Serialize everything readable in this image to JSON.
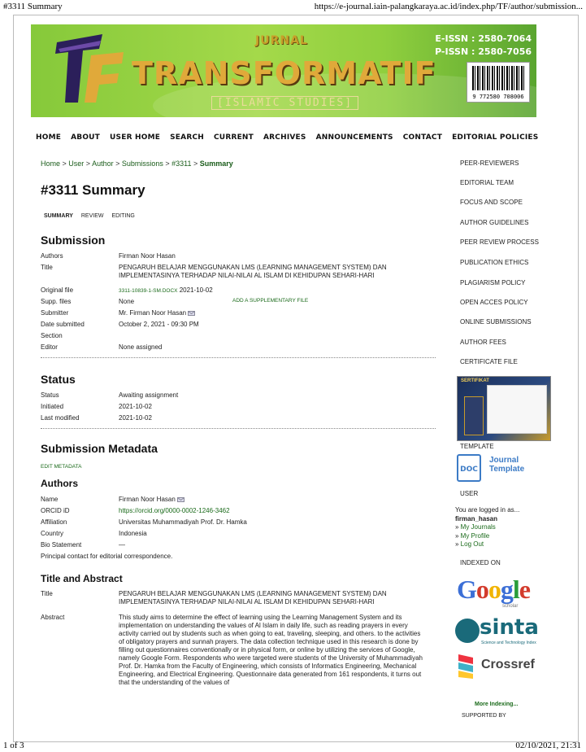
{
  "print_header": {
    "title": "#3311 Summary",
    "url": "https://e-journal.iain-palangkaraya.ac.id/index.php/TF/author/submission..."
  },
  "print_footer": {
    "page": "1 of 3",
    "datetime": "02/10/2021, 21:31"
  },
  "banner": {
    "jurnal": "JURNAL",
    "name": "TRANSFORMATIF",
    "subtitle": "[ISLAMIC STUDIES]",
    "eissn": "E-ISSN : 2580-7064",
    "pissn": "P-ISSN : 2580-7056",
    "barcode_number": "9 772580 708006"
  },
  "nav": [
    "HOME",
    "ABOUT",
    "USER HOME",
    "SEARCH",
    "CURRENT",
    "ARCHIVES",
    "ANNOUNCEMENTS",
    "CONTACT",
    "EDITORIAL POLICIES"
  ],
  "breadcrumb": {
    "items": [
      "Home",
      "User",
      "Author",
      "Submissions",
      "#3311"
    ],
    "sep": " > ",
    "current": "Summary"
  },
  "page_title": "#3311 Summary",
  "tabs": {
    "summary": "SUMMARY",
    "review": "REVIEW",
    "editing": "EDITING"
  },
  "submission": {
    "heading": "Submission",
    "authors_label": "Authors",
    "authors": "Firman Noor Hasan",
    "title_label": "Title",
    "title": "PENGARUH BELAJAR MENGGUNAKAN LMS (LEARNING MANAGEMENT SYSTEM) DAN IMPLEMENTASINYA TERHADAP NILAI-NILAI AL ISLAM DI KEHIDUPAN SEHARI-HARI",
    "file_label": "Original file",
    "file_name": "3311-10839-1-SM.DOCX",
    "file_date": "2021-10-02",
    "supp_label": "Supp. files",
    "supp": "None",
    "add_supp": "ADD A SUPPLEMENTARY FILE",
    "submitter_label": "Submitter",
    "submitter": "Mr. Firman Noor Hasan",
    "date_label": "Date submitted",
    "date": "October 2, 2021 - 09:30 PM",
    "section_label": "Section",
    "editor_label": "Editor",
    "editor": "None assigned"
  },
  "status": {
    "heading": "Status",
    "status_label": "Status",
    "status": "Awaiting assignment",
    "initiated_label": "Initiated",
    "initiated": "2021-10-02",
    "modified_label": "Last modified",
    "modified": "2021-10-02"
  },
  "metadata": {
    "heading": "Submission Metadata",
    "edit_link": "EDIT METADATA",
    "authors_heading": "Authors",
    "name_label": "Name",
    "name": "Firman Noor Hasan",
    "orcid_label": "ORCID iD",
    "orcid": "https://orcid.org/0000-0002-1246-3462",
    "affil_label": "Affiliation",
    "affil": "Universitas Muhammadiyah Prof. Dr. Hamka",
    "country_label": "Country",
    "country": "Indonesia",
    "bio_label": "Bio Statement",
    "bio": "—",
    "principal": "Principal contact for editorial correspondence.",
    "ta_heading": "Title and Abstract",
    "title_label": "Title",
    "title": "PENGARUH BELAJAR MENGGUNAKAN LMS (LEARNING MANAGEMENT SYSTEM) DAN IMPLEMENTASINYA TERHADAP NILAI-NILAI AL ISLAM DI KEHIDUPAN SEHARI-HARI",
    "abstract_label": "Abstract",
    "abstract": "This study aims to determine the effect of learning using the Learning Management System and its implementation on understanding the values of Al Islam in daily life, such as reading prayers in every activity carried out by students such as when going to eat, traveling, sleeping, and others. to the activities of obligatory prayers and sunnah prayers. The data collection technique used in this research is done by filling out questionnaires conventionally or in physical form, or online by utilizing the services of Google, namely Google Form. Respondents who were targeted were students of the University of Muhammadiyah Prof. Dr. Hamka from the Faculty of Engineering, which consists of Informatics Engineering, Mechanical Engineering, and Electrical Engineering. Questionnaire data generated from 161 respondents, it turns out that the understanding of the values of"
  },
  "sidebar": {
    "links": [
      "PEER-REVIEWERS",
      "EDITORIAL TEAM",
      "FOCUS AND SCOPE",
      "AUTHOR GUIDELINES",
      "PEER REVIEW PROCESS",
      "PUBLICATION ETHICS",
      "PLAGIARISM POLICY",
      "OPEN ACCES POLICY",
      "ONLINE SUBMISSIONS",
      "AUTHOR FEES",
      "CERTIFICATE FILE"
    ],
    "cert_label": "SERTIFIKAT",
    "template_heading": "TEMPLATE",
    "doc_badge": "DOC",
    "doc_text_1": "Journal",
    "doc_text_2": "Template",
    "user_heading": "USER",
    "logged_in": "You are logged in as...",
    "username": "firman_hasan",
    "user_links": [
      "My Journals",
      "My Profile",
      "Log Out"
    ],
    "indexed_heading": "INDEXED ON",
    "google_letters": [
      "G",
      "o",
      "o",
      "g",
      "l",
      "e"
    ],
    "google_colors": [
      "#3c6fd6",
      "#d33b2c",
      "#f1b400",
      "#3c6fd6",
      "#2a9d3a",
      "#d33b2c"
    ],
    "google_sub": "scholar",
    "sinta": "sinta",
    "sinta_sub": "Science and Technology Index",
    "crossref": "Crossref",
    "more_indexing": "More Indexing...",
    "supported_by": "SUPPORTED BY"
  }
}
